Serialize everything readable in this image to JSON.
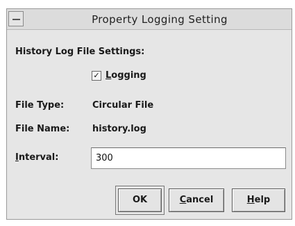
{
  "window": {
    "title": "Property Logging Setting"
  },
  "section": {
    "heading": "History Log File Settings:"
  },
  "logging": {
    "check_mark": "✓",
    "label_mnemonic": "L",
    "label_rest": "ogging",
    "checked": true
  },
  "file_type": {
    "label": "File Type:",
    "value": "Circular File"
  },
  "file_name": {
    "label": "File Name:",
    "value": "history.log"
  },
  "interval": {
    "label_mnemonic": "I",
    "label_rest": "nterval:",
    "value": "300"
  },
  "buttons": {
    "ok": "OK",
    "cancel_mnemonic": "C",
    "cancel_rest": "ancel",
    "help_mnemonic": "H",
    "help_rest": "elp"
  }
}
